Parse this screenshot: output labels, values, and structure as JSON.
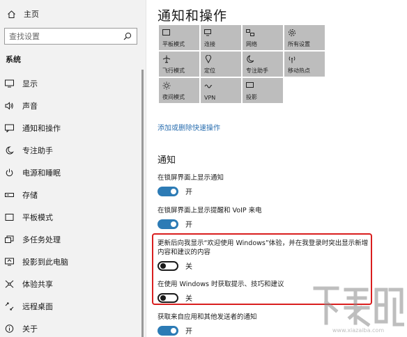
{
  "sidebar": {
    "home_label": "主页",
    "search_placeholder": "查找设置",
    "section_label": "系统",
    "items": [
      {
        "label": "显示",
        "icon": "monitor-icon"
      },
      {
        "label": "声音",
        "icon": "speaker-icon"
      },
      {
        "label": "通知和操作",
        "icon": "notification-icon"
      },
      {
        "label": "专注助手",
        "icon": "moon-icon"
      },
      {
        "label": "电源和睡眠",
        "icon": "power-icon"
      },
      {
        "label": "存储",
        "icon": "storage-icon"
      },
      {
        "label": "平板模式",
        "icon": "tablet-icon"
      },
      {
        "label": "多任务处理",
        "icon": "multitask-icon"
      },
      {
        "label": "投影到此电脑",
        "icon": "project-icon"
      },
      {
        "label": "体验共享",
        "icon": "share-icon"
      },
      {
        "label": "远程桌面",
        "icon": "remote-desktop-icon"
      },
      {
        "label": "关于",
        "icon": "info-icon"
      }
    ]
  },
  "main": {
    "title": "通知和操作",
    "quick_actions": [
      {
        "label": "平板模式",
        "icon": "tablet-icon"
      },
      {
        "label": "连接",
        "icon": "connect-icon"
      },
      {
        "label": "网络",
        "icon": "network-icon"
      },
      {
        "label": "所有设置",
        "icon": "gear-icon"
      },
      {
        "label": "飞行模式",
        "icon": "airplane-icon"
      },
      {
        "label": "定位",
        "icon": "location-icon"
      },
      {
        "label": "专注助手",
        "icon": "moon-icon"
      },
      {
        "label": "移动热点",
        "icon": "hotspot-icon"
      },
      {
        "label": "夜间模式",
        "icon": "brightness-icon"
      },
      {
        "label": "VPN",
        "icon": "vpn-icon"
      },
      {
        "label": "投影",
        "icon": "project-icon"
      }
    ],
    "edit_link": "添加或删除快速操作",
    "notifications_heading": "通知",
    "options": [
      {
        "label": "在锁屏界面上显示通知",
        "state": "开",
        "on": true
      },
      {
        "label": "在锁屏界面上显示提醒和 VoIP 来电",
        "state": "开",
        "on": true
      },
      {
        "label": "更新后向我显示“欢迎使用 Windows”体验，并在我登录时突出显示新增内容和建议的内容",
        "state": "关",
        "on": false
      },
      {
        "label": "在使用 Windows 时获取提示、技巧和建议",
        "state": "关",
        "on": false
      },
      {
        "label": "获取来自应用和其他发送者的通知",
        "state": "开",
        "on": true
      }
    ]
  },
  "watermark": {
    "text": "下载吧",
    "url": "www.xiazaiba.com"
  },
  "colors": {
    "accent": "#2c7bb5",
    "highlight_border": "#d91e1e",
    "tile": "#bdbdbd"
  }
}
